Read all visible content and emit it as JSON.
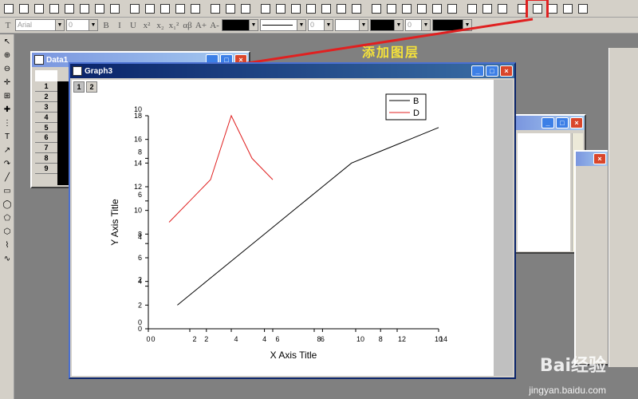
{
  "toolbar": {
    "top_buttons": [
      "new-project-icon",
      "new-worksheet-icon",
      "new-graph-icon",
      "new-matrix-icon",
      "new-function-icon",
      "new-layout-icon",
      "new-excel-icon",
      "new-notes-icon",
      "open-icon",
      "open-template-icon",
      "open-excel-icon",
      "save-icon",
      "save-template-icon",
      "import-ascii-icon",
      "import-multi-icon",
      "import-excel-icon",
      "print-icon",
      "duplicate-icon",
      "refresh-icon",
      "project-explorer-icon",
      "results-log-icon",
      "code-builder-icon",
      "command-window-icon",
      "add-new-column-icon",
      "plot-setup-icon",
      "zoom-in-icon",
      "zoom-out-icon",
      "whole-page-icon",
      "rescale-icon",
      "layer-arrange-icon",
      "merge-graph-icon",
      "extract-layer-icon",
      "add-bottom-x-left-y-icon",
      "add-top-x-right-y-icon",
      "add-right-y-icon",
      "add-top-x-icon",
      "add-inset-icon"
    ],
    "font_name": "Arial",
    "font_size": "0",
    "style_buttons": [
      "B",
      "I",
      "U",
      "x²",
      "x₂",
      "x₁²",
      "αβ",
      "A+",
      "A-"
    ],
    "line_width": "0",
    "pattern_width": "0"
  },
  "left_tools": [
    "pointer-icon",
    "zoom-icon",
    "zoom-out-icon",
    "screen-reader-icon",
    "data-reader-icon",
    "data-selector-icon",
    "draw-data-icon",
    "text-tool-icon",
    "arrow-tool-icon",
    "curved-arrow-icon",
    "line-tool-icon",
    "rectangle-tool-icon",
    "ellipse-tool-icon",
    "polygon-tool-icon",
    "region-tool-icon",
    "polyline-tool-icon",
    "freehand-tool-icon"
  ],
  "annotation": "添加图层",
  "data_window": {
    "title": "Data1",
    "rows": [
      "1",
      "2",
      "3",
      "4",
      "5",
      "6",
      "7",
      "8",
      "9"
    ]
  },
  "graph_window": {
    "title": "Graph3",
    "layer_tabs": [
      "1",
      "2"
    ],
    "legend": [
      {
        "name": "B",
        "color": "#000000"
      },
      {
        "name": "D",
        "color": "#e02020"
      }
    ]
  },
  "watermark": {
    "brand": "Bai经验",
    "url": "jingyan.baidu.com"
  },
  "chart_data": {
    "type": "line",
    "title": "",
    "xlabel": "X Axis Title",
    "ylabel": "Y Axis Title",
    "layer1": {
      "xlim": [
        0,
        10
      ],
      "ylim": [
        0,
        18
      ],
      "xticks": [
        "0",
        "2",
        "4",
        "6",
        "8",
        "10"
      ],
      "yticks": [
        "0",
        "2",
        "4",
        "6",
        "8",
        "10",
        "12",
        "14",
        "16",
        "18"
      ],
      "series": [
        {
          "name": "B",
          "color": "#000000",
          "x": [
            1,
            2,
            3,
            4,
            5,
            6,
            7,
            8,
            9,
            10
          ],
          "y": [
            2,
            4,
            6,
            8,
            10,
            12,
            14,
            15,
            16,
            17
          ]
        }
      ]
    },
    "layer2": {
      "xlim": [
        0,
        14
      ],
      "ylim": [
        0,
        10
      ],
      "xticks": [
        "0",
        "2",
        "4",
        "6",
        "8",
        "10",
        "12",
        "14"
      ],
      "yticks": [
        "0",
        "2",
        "4",
        "6",
        "8",
        "10"
      ],
      "series": [
        {
          "name": "D",
          "color": "#e02020",
          "x": [
            1,
            2,
            3,
            4,
            5,
            6
          ],
          "y": [
            5,
            6,
            7,
            10,
            8,
            7
          ]
        }
      ]
    }
  }
}
